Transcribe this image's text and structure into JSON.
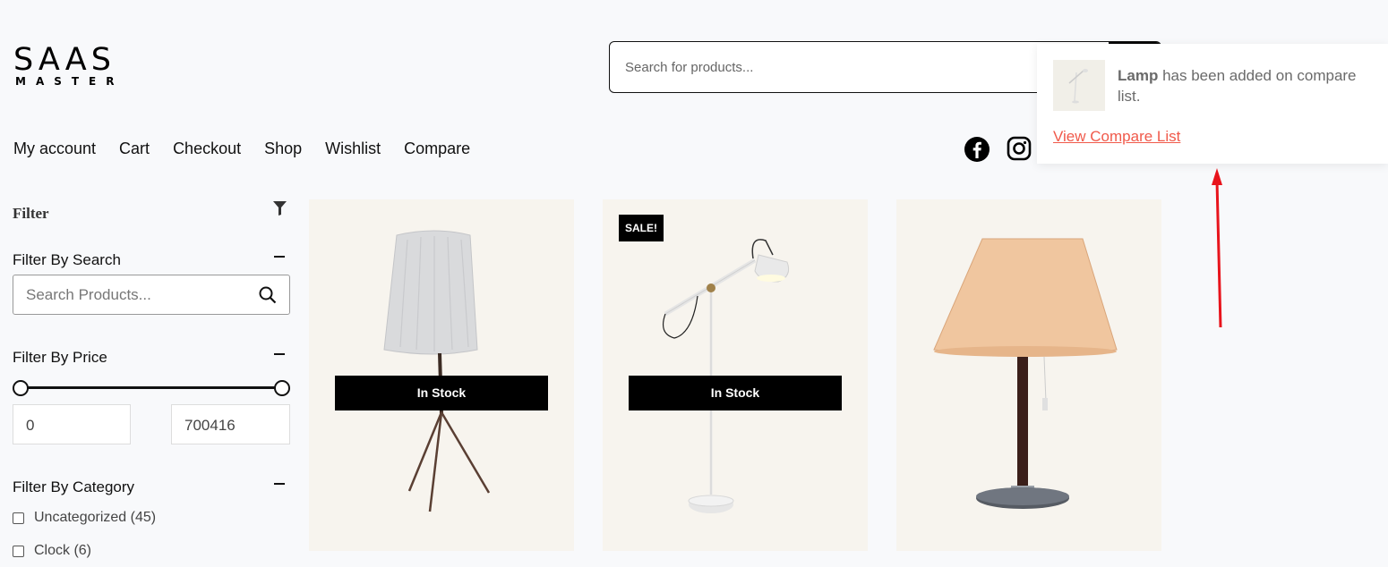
{
  "logo": {
    "main": "SAAS",
    "sub": "MASTER"
  },
  "search": {
    "placeholder": "Search for products..."
  },
  "nav": {
    "items": [
      "My account",
      "Cart",
      "Checkout",
      "Shop",
      "Wishlist",
      "Compare"
    ]
  },
  "social": {
    "icons": [
      "facebook-icon",
      "instagram-icon"
    ]
  },
  "toast": {
    "product": "Lamp",
    "message": " has been added on compare list.",
    "link": "View Compare List"
  },
  "sidebar": {
    "title": "Filter",
    "search_section": {
      "title": "Filter By Search",
      "placeholder": "Search Products..."
    },
    "price_section": {
      "title": "Filter By Price",
      "min": "0",
      "max": "700416"
    },
    "category_section": {
      "title": "Filter By Category",
      "items": [
        {
          "label": "Uncategorized (45)"
        },
        {
          "label": "Clock (6)"
        }
      ]
    }
  },
  "products": [
    {
      "stock": "In Stock",
      "sale": ""
    },
    {
      "stock": "In Stock",
      "sale": "SALE!"
    },
    {
      "stock": "",
      "sale": ""
    }
  ],
  "colors": {
    "accent": "#f0594a",
    "arrow": "#e8141c",
    "card_bg": "#f7f4ee"
  }
}
